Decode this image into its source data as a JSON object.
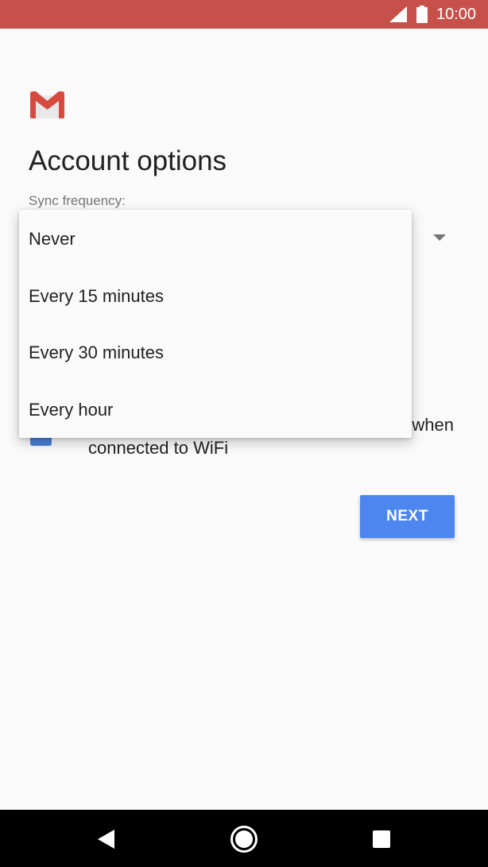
{
  "status_bar": {
    "time": "10:00",
    "icons": [
      "signal-icon",
      "battery-icon"
    ],
    "color": "#c8504a"
  },
  "header": {
    "logo": "gmail-logo",
    "title": "Account options"
  },
  "sync": {
    "label": "Sync frequency:",
    "options": [
      {
        "label": "Never"
      },
      {
        "label": "Every 15 minutes"
      },
      {
        "label": "Every 30 minutes"
      },
      {
        "label": "Every hour"
      }
    ]
  },
  "attachments_option": {
    "checked": true,
    "text_line_1_visible": "when",
    "text_line_2": "connected to WiFi"
  },
  "next_button": {
    "label": "NEXT",
    "color": "#4e86ef"
  },
  "nav_bar": {
    "icons": [
      "back-icon",
      "home-icon",
      "recents-icon"
    ]
  }
}
